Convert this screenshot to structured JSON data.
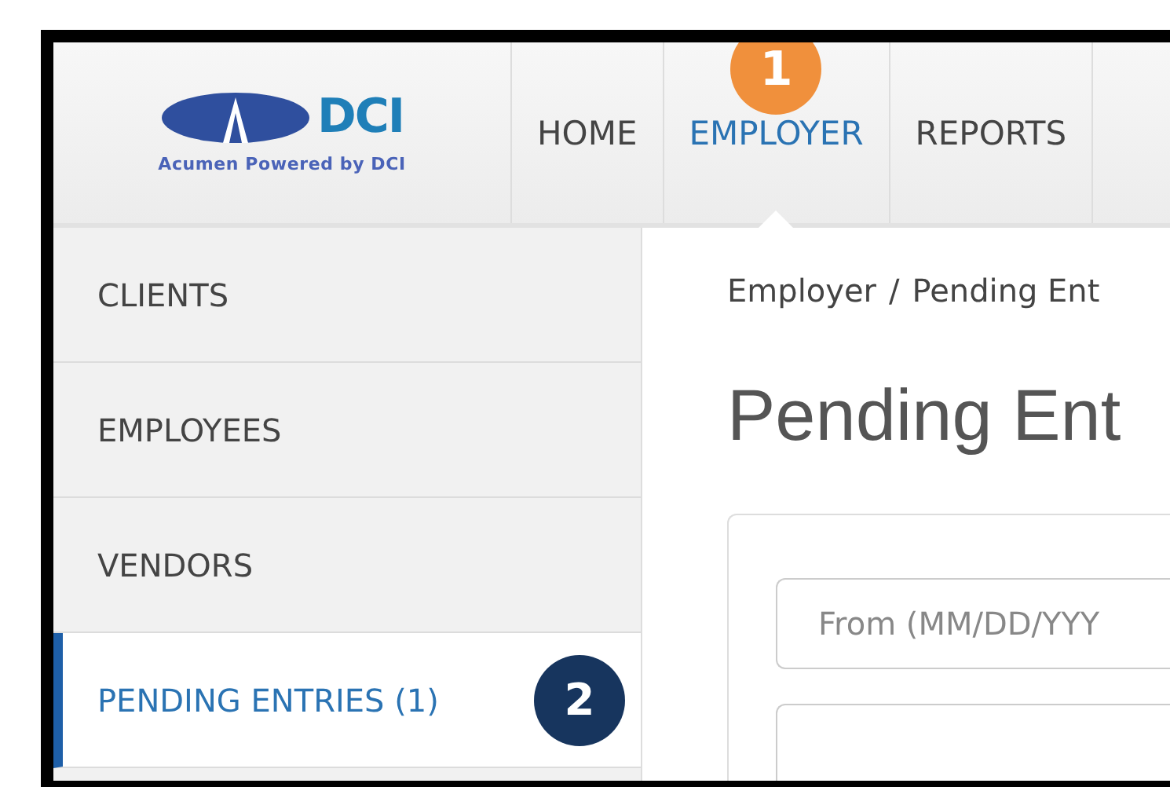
{
  "logo": {
    "wordmark": "DCI",
    "tagline": "Acumen Powered by DCI"
  },
  "nav": [
    {
      "label": "HOME",
      "selected": false
    },
    {
      "label": "EMPLOYER",
      "selected": true,
      "callout": {
        "number": "1",
        "color": "#f0903c"
      }
    },
    {
      "label": "REPORTS",
      "selected": false
    }
  ],
  "sidebar": {
    "items": [
      {
        "label": "CLIENTS",
        "selected": false
      },
      {
        "label": "EMPLOYEES",
        "selected": false
      },
      {
        "label": "VENDORS",
        "selected": false
      },
      {
        "label": "PENDING ENTRIES (1)",
        "selected": true,
        "callout": {
          "number": "2",
          "color": "#17355e"
        }
      }
    ]
  },
  "breadcrumb": [
    "Employer",
    "Pending Ent"
  ],
  "breadcrumb_separator": "/",
  "title": "Pending Ent",
  "filter": {
    "from": {
      "placeholder": "From (MM/DD/YYY"
    }
  }
}
